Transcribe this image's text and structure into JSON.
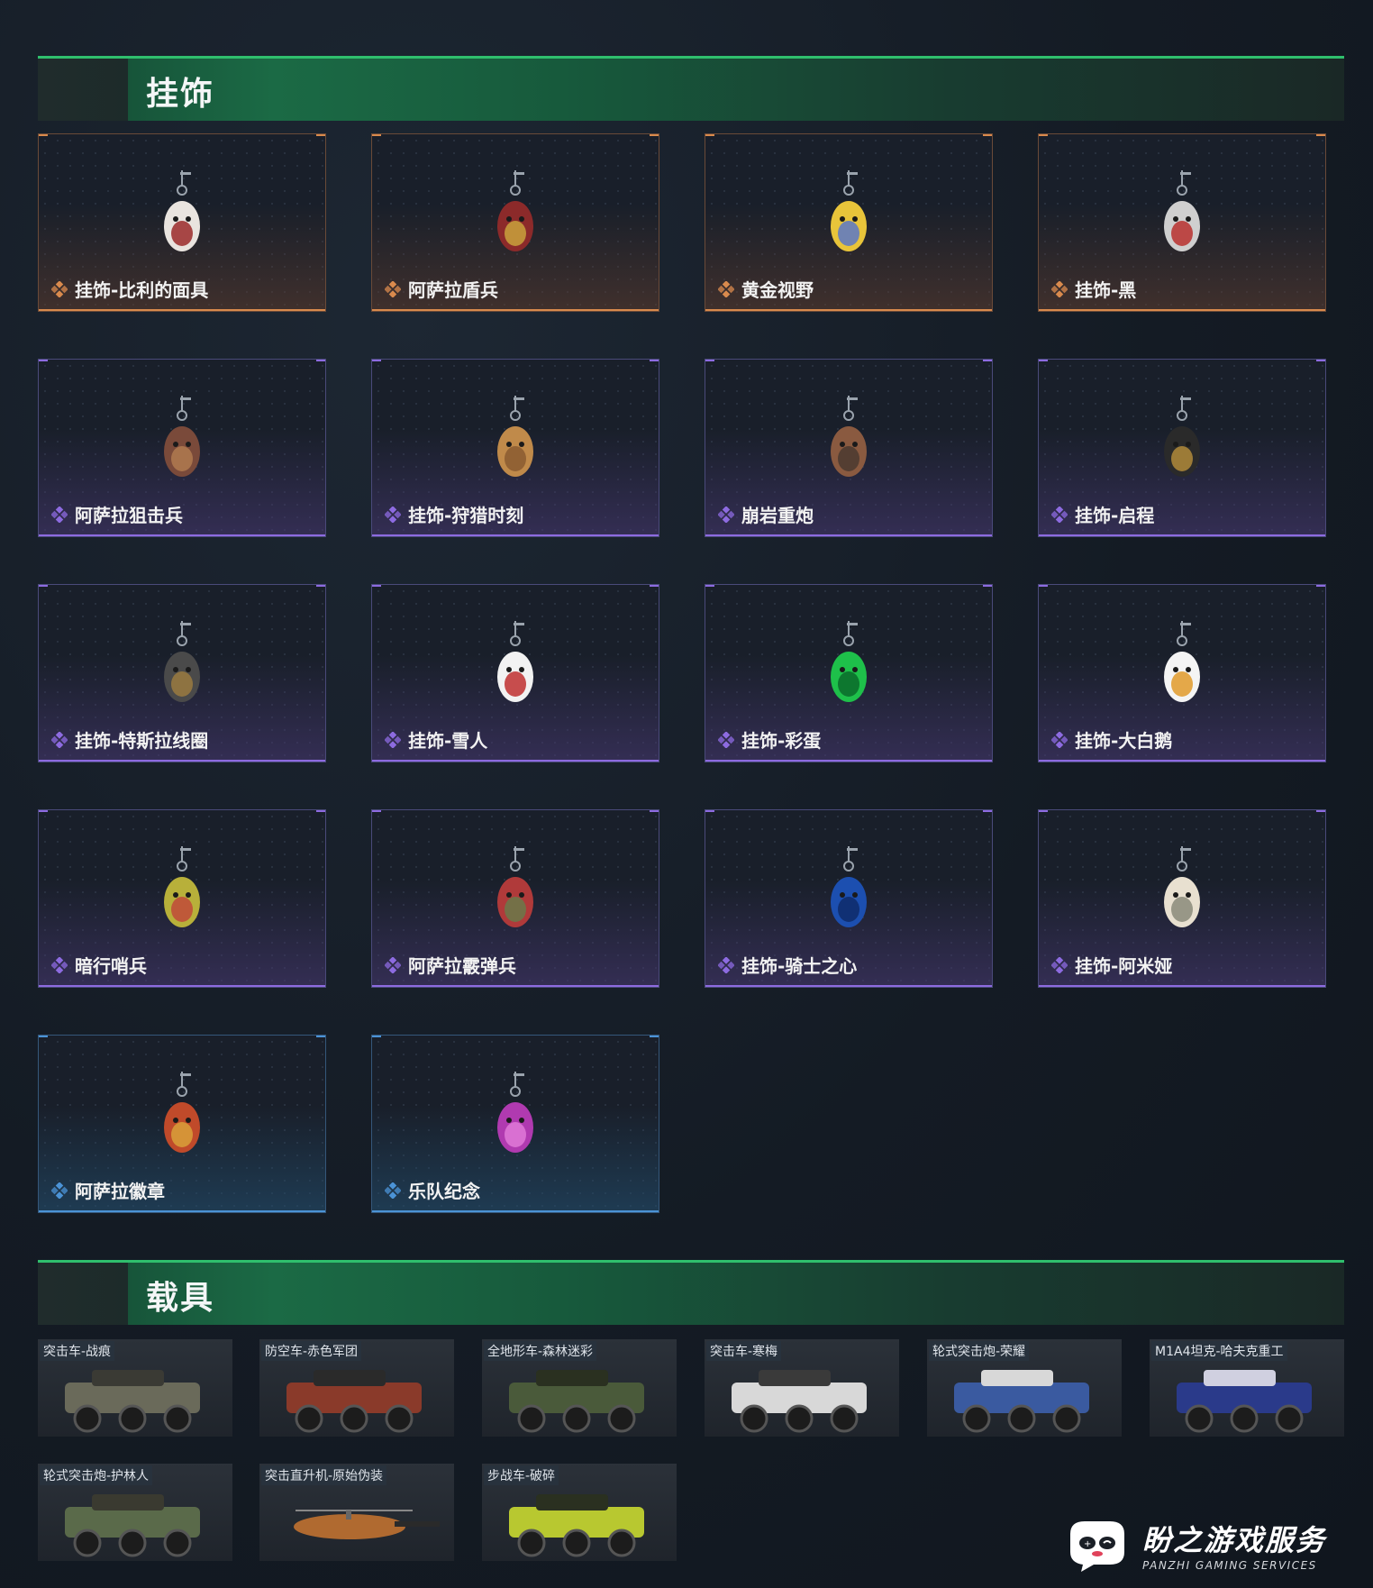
{
  "sections": {
    "charms_title": "挂饰",
    "vehicles_title": "载具"
  },
  "charms": [
    {
      "label": "挂饰-比利的面具",
      "rarity": "orange",
      "icon": "billy-mask-charm-icon"
    },
    {
      "label": "阿萨拉盾兵",
      "rarity": "orange",
      "icon": "shield-soldier-charm-icon"
    },
    {
      "label": "黄金视野",
      "rarity": "orange",
      "icon": "golden-vision-charm-icon"
    },
    {
      "label": "挂饰-黑",
      "rarity": "orange",
      "icon": "black-card-charm-icon"
    },
    {
      "label": "阿萨拉狙击兵",
      "rarity": "purple",
      "icon": "sniper-charm-icon"
    },
    {
      "label": "挂饰-狩猎时刻",
      "rarity": "purple",
      "icon": "antler-charm-icon"
    },
    {
      "label": "崩岩重炮",
      "rarity": "purple",
      "icon": "heavy-cannon-charm-icon"
    },
    {
      "label": "挂饰-启程",
      "rarity": "purple",
      "icon": "medal-charm-icon"
    },
    {
      "label": "挂饰-特斯拉线圈",
      "rarity": "purple",
      "icon": "tesla-coil-charm-icon"
    },
    {
      "label": "挂饰-雪人",
      "rarity": "purple",
      "icon": "snowman-charm-icon"
    },
    {
      "label": "挂饰-彩蛋",
      "rarity": "purple",
      "icon": "easter-egg-charm-icon"
    },
    {
      "label": "挂饰-大白鹅",
      "rarity": "purple",
      "icon": "goose-charm-icon"
    },
    {
      "label": "暗行哨兵",
      "rarity": "purple",
      "icon": "sentinel-charm-icon"
    },
    {
      "label": "阿萨拉霰弹兵",
      "rarity": "purple",
      "icon": "shotgunner-charm-icon"
    },
    {
      "label": "挂饰-骑士之心",
      "rarity": "purple",
      "icon": "knight-heart-charm-icon"
    },
    {
      "label": "挂饰-阿米娅",
      "rarity": "purple",
      "icon": "amiya-charm-icon"
    },
    {
      "label": "阿萨拉徽章",
      "rarity": "blue",
      "icon": "badge-charm-icon"
    },
    {
      "label": "乐队纪念",
      "rarity": "blue",
      "icon": "band-badge-charm-icon"
    }
  ],
  "vehicles": [
    {
      "label": "突击车-战痕"
    },
    {
      "label": "防空车-赤色军团"
    },
    {
      "label": "全地形车-森林迷彩"
    },
    {
      "label": "突击车-寒梅"
    },
    {
      "label": "轮式突击炮-荣耀"
    },
    {
      "label": "M1A4坦克-哈夫克重工"
    },
    {
      "label": "轮式突击炮-护林人"
    },
    {
      "label": "突击直升机-原始伪装"
    },
    {
      "label": "步战车-破碎"
    }
  ],
  "watermark": {
    "name": "盼之游戏服务",
    "sub": "PANZHI GAMING SERVICES"
  },
  "colors": {
    "orange": "#d98a4d",
    "purple": "#8d6be0",
    "blue": "#4b93d6",
    "header_green": "#1b6a45"
  }
}
